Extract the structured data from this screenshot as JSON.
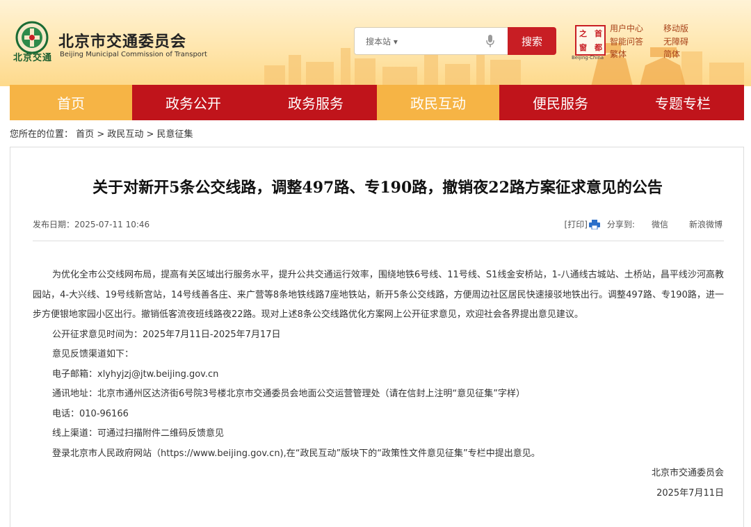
{
  "header": {
    "logo_short": "北京交通",
    "title": "北京市交通委员会",
    "subtitle": "Beijing Municipal Commission of Transport",
    "search": {
      "scope_label": "搜本站",
      "placeholder": "",
      "button_label": "搜索"
    },
    "seal": {
      "chars": [
        "首",
        "都",
        "之",
        "窗"
      ],
      "caption": "Beijing·China"
    },
    "top_links": [
      "用户中心",
      "移动版",
      "智能问答",
      "无障碍",
      "繁体",
      "简体"
    ]
  },
  "nav": {
    "items": [
      {
        "label": "首页",
        "active": true
      },
      {
        "label": "政务公开",
        "active": false
      },
      {
        "label": "政务服务",
        "active": false
      },
      {
        "label": "政民互动",
        "active": true
      },
      {
        "label": "便民服务",
        "active": false
      },
      {
        "label": "专题专栏",
        "active": false
      }
    ]
  },
  "breadcrumb": {
    "prefix": "您所在的位置：",
    "items": [
      "首页",
      "政民互动",
      "民意征集"
    ],
    "separator": " > "
  },
  "article": {
    "title": "关于对新开5条公交线路，调整497路、专190路，撤销夜22路方案征求意见的公告",
    "date_label": "发布日期：",
    "date_value": "2025-07-11 10:46",
    "print_label": "[打印]",
    "share_label": "分享到:",
    "share_links": [
      "微信",
      "新浪微博"
    ],
    "intro": "为优化全市公交线网布局，提高有关区域出行服务水平，提升公共交通运行效率，围绕地铁6号线、11号线、S1线金安桥站，1-八通线古城站、土桥站，昌平线沙河高教园站，4-大兴线、19号线新宫站，14号线善各庄、来广营等8条地铁线路7座地铁站，新开5条公交线路，方便周边社区居民快速接驳地铁出行。调整497路、专190路，进一步方便银地家园小区出行。撤销低客流夜班线路夜22路。现对上述8条公交线路优化方案网上公开征求意见，欢迎社会各界提出意见建议。",
    "lines": [
      "公开征求意见时间为：2025年7月11日-2025年7月17日",
      "意见反馈渠道如下：",
      "电子邮箱：xlyhyjzj@jtw.beijing.gov.cn",
      "通讯地址：北京市通州区达济街6号院3号楼北京市交通委员会地面公交运营管理处（请在信封上注明“意见征集”字样）",
      "电话：010-96166",
      "线上渠道：可通过扫描附件二维码反馈意见",
      "登录北京市人民政府网站（https://www.beijing.gov.cn),在“政民互动”版块下的“政策性文件意见征集”专栏中提出意见。"
    ],
    "signature": "北京市交通委员会",
    "signature_date": "2025年7月11日"
  },
  "colors": {
    "brand_red": "#c0141b",
    "nav_active": "#f6b445",
    "header_bg": "#ffe6ae"
  }
}
